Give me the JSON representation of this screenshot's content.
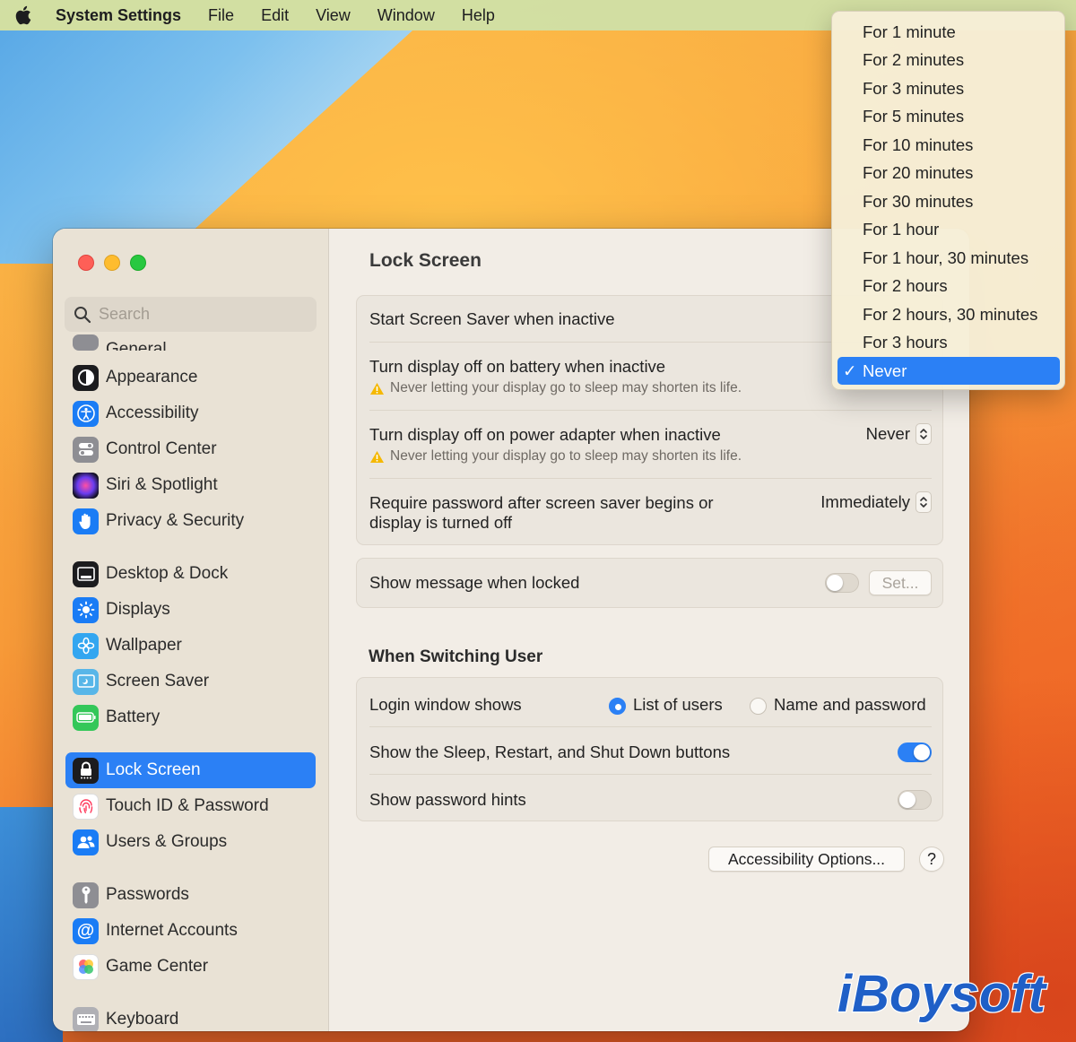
{
  "menubar": {
    "app_name": "System Settings",
    "items": [
      "File",
      "Edit",
      "View",
      "Window",
      "Help"
    ]
  },
  "search": {
    "placeholder": "Search"
  },
  "sidebar": {
    "items": [
      {
        "label": "General",
        "icon": "gear-icon",
        "color": "#8e8e93"
      },
      {
        "label": "Appearance",
        "icon": "appearance-icon",
        "color": "#1c1c1e"
      },
      {
        "label": "Accessibility",
        "icon": "accessibility-icon",
        "color": "#1a7cf5"
      },
      {
        "label": "Control Center",
        "icon": "control-center-icon",
        "color": "#8e8e93"
      },
      {
        "label": "Siri & Spotlight",
        "icon": "siri-icon",
        "color": "#5b3fd0"
      },
      {
        "label": "Privacy & Security",
        "icon": "hand-icon",
        "color": "#1a7cf5"
      },
      {
        "label": "Desktop & Dock",
        "icon": "dock-icon",
        "color": "#1c1c1e"
      },
      {
        "label": "Displays",
        "icon": "sun-icon",
        "color": "#1a7cf5"
      },
      {
        "label": "Wallpaper",
        "icon": "flower-icon",
        "color": "#33a6f0"
      },
      {
        "label": "Screen Saver",
        "icon": "screen-saver-icon",
        "color": "#58b6e8"
      },
      {
        "label": "Battery",
        "icon": "battery-icon",
        "color": "#34c759"
      },
      {
        "label": "Lock Screen",
        "icon": "lock-icon",
        "color": "#1c1c1e"
      },
      {
        "label": "Touch ID & Password",
        "icon": "fingerprint-icon",
        "color": "#ffffff"
      },
      {
        "label": "Users & Groups",
        "icon": "users-icon",
        "color": "#1a7cf5"
      },
      {
        "label": "Passwords",
        "icon": "key-icon",
        "color": "#8e8e93"
      },
      {
        "label": "Internet Accounts",
        "icon": "at-icon",
        "color": "#1a7cf5"
      },
      {
        "label": "Game Center",
        "icon": "game-center-icon",
        "color": "#ffffff"
      },
      {
        "label": "Keyboard",
        "icon": "keyboard-icon",
        "color": "#b0b0b5"
      }
    ]
  },
  "main": {
    "title": "Lock Screen",
    "screen_saver_label": "Start Screen Saver when inactive",
    "battery_label": "Turn display off on battery when inactive",
    "battery_warning": "Never letting your display go to sleep may shorten its life.",
    "adapter_label": "Turn display off on power adapter when inactive",
    "adapter_value": "Never",
    "adapter_warning": "Never letting your display go to sleep may shorten its life.",
    "password_label_line1": "Require password after screen saver begins or",
    "password_label_line2": "display is turned off",
    "password_value": "Immediately",
    "message_label": "Show message when locked",
    "set_button": "Set...",
    "switching_title": "When Switching User",
    "login_label": "Login window shows",
    "login_option1": "List of users",
    "login_option2": "Name and password",
    "sleep_buttons_label": "Show the Sleep, Restart, and Shut Down buttons",
    "password_hints_label": "Show password hints",
    "accessibility_button": "Accessibility Options...",
    "help_button": "?",
    "toggles": {
      "message_locked": false,
      "sleep_buttons": true,
      "password_hints": false
    }
  },
  "dropdown": {
    "options": [
      "For 1 minute",
      "For 2 minutes",
      "For 3 minutes",
      "For 5 minutes",
      "For 10 minutes",
      "For 20 minutes",
      "For 30 minutes",
      "For 1 hour",
      "For 1 hour, 30 minutes",
      "For 2 hours",
      "For 2 hours, 30 minutes",
      "For 3 hours",
      "Never"
    ],
    "selected": "Never",
    "check": "✓"
  },
  "watermark": {
    "text": "iBoysoft"
  },
  "colors": {
    "accent": "#2b80f5"
  }
}
